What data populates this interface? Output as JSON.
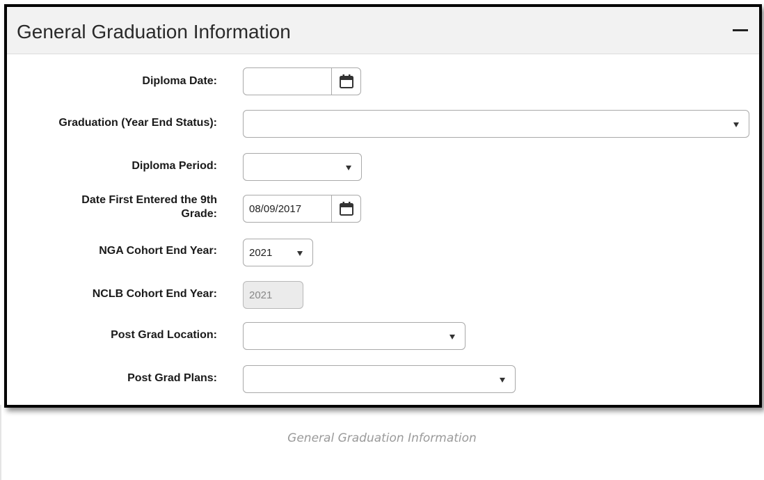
{
  "section": {
    "title": "General Graduation Information",
    "collapse_icon": "minus-icon"
  },
  "fields": {
    "diploma_date": {
      "label": "Diploma Date:",
      "value": ""
    },
    "graduation_status": {
      "label": "Graduation (Year End Status):",
      "value": ""
    },
    "diploma_period": {
      "label": "Diploma Period:",
      "value": ""
    },
    "date_first_9th": {
      "label_line1": "Date First Entered the 9th",
      "label_line2": "Grade:",
      "value": "08/09/2017"
    },
    "nga_cohort": {
      "label": "NGA Cohort End Year:",
      "value": "2021"
    },
    "nclb_cohort": {
      "label": "NCLB Cohort End Year:",
      "value": "2021"
    },
    "post_grad_location": {
      "label": "Post Grad Location:",
      "value": ""
    },
    "post_grad_plans": {
      "label": "Post Grad Plans:",
      "value": ""
    }
  },
  "icons": {
    "calendar": "calendar-icon",
    "dropdown": "chevron-down-icon"
  },
  "caption": "General Graduation Information"
}
